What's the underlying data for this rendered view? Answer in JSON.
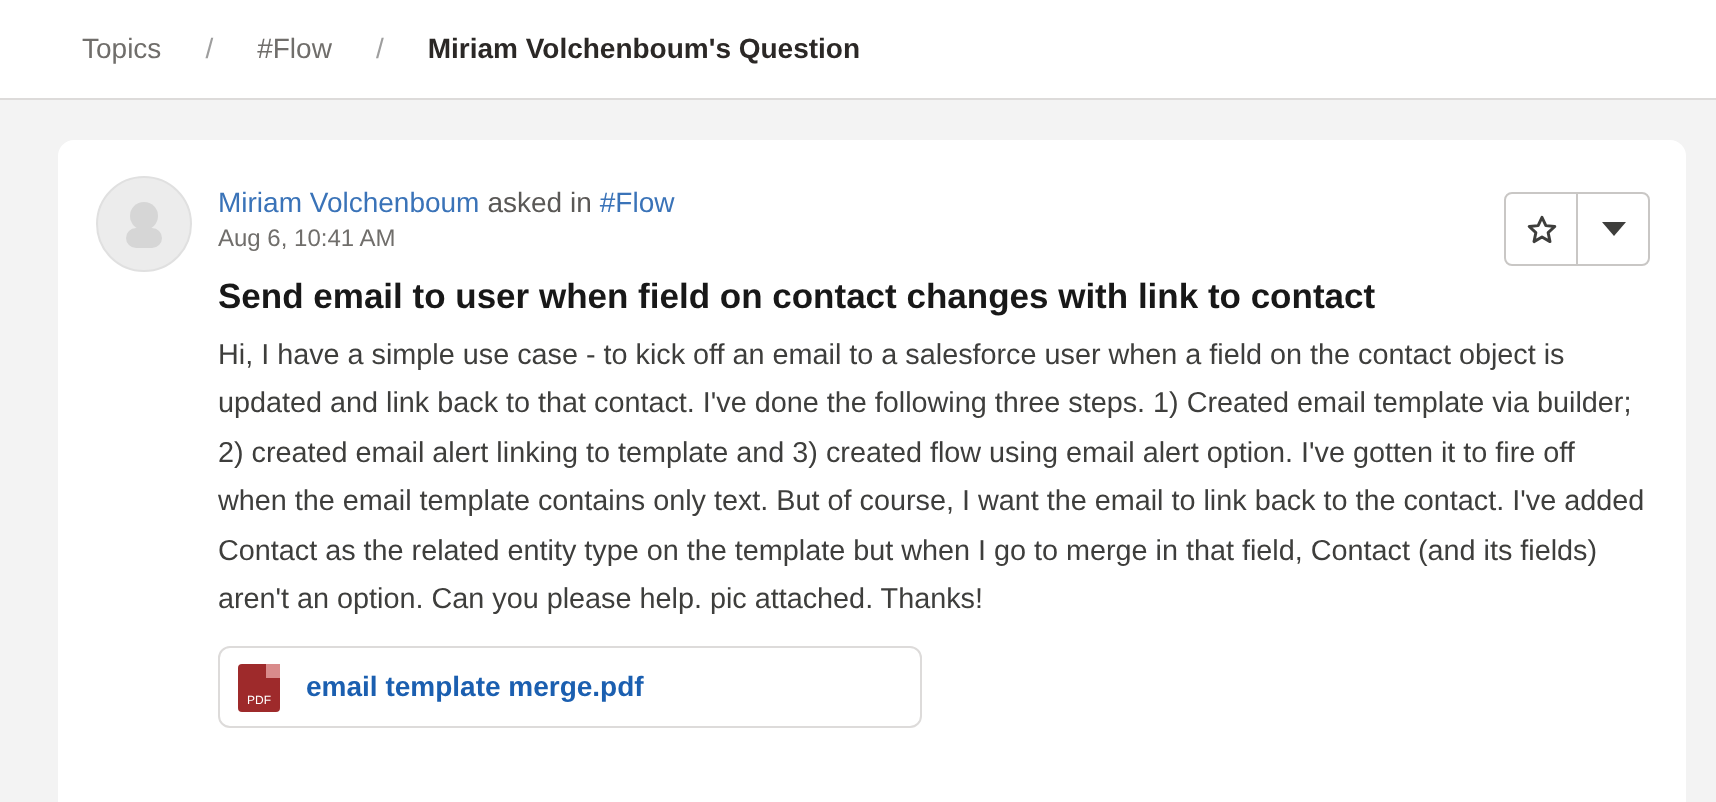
{
  "breadcrumb_separator": "/",
  "breadcrumb": [
    {
      "label": "Topics",
      "current": false
    },
    {
      "label": "#Flow",
      "current": false
    },
    {
      "label": "Miriam Volchenboum's Question",
      "current": true
    }
  ],
  "question": {
    "author": "Miriam Volchenboum",
    "asked_in": "asked in",
    "topic": "#Flow",
    "time": "Aug 6, 10:41 AM",
    "title": "Send email to user when field on contact changes with link to contact",
    "body": "Hi, I have a simple use case - to kick off an email to a salesforce user when a field on the contact object is updated and link back to that contact. I've done the following three steps. 1) Created email template via builder; 2) created email alert linking to template and 3) created flow using email alert option. I've gotten it to fire off when the email template contains only text. But of course, I want the email to link back to the contact. I've added Contact as the related entity type on the template but when I go to merge in that field, Contact (and its fields) aren't an option. Can you please help. pic attached. Thanks!",
    "attachment": {
      "file_type": "PDF",
      "name": "email template merge.pdf"
    }
  }
}
